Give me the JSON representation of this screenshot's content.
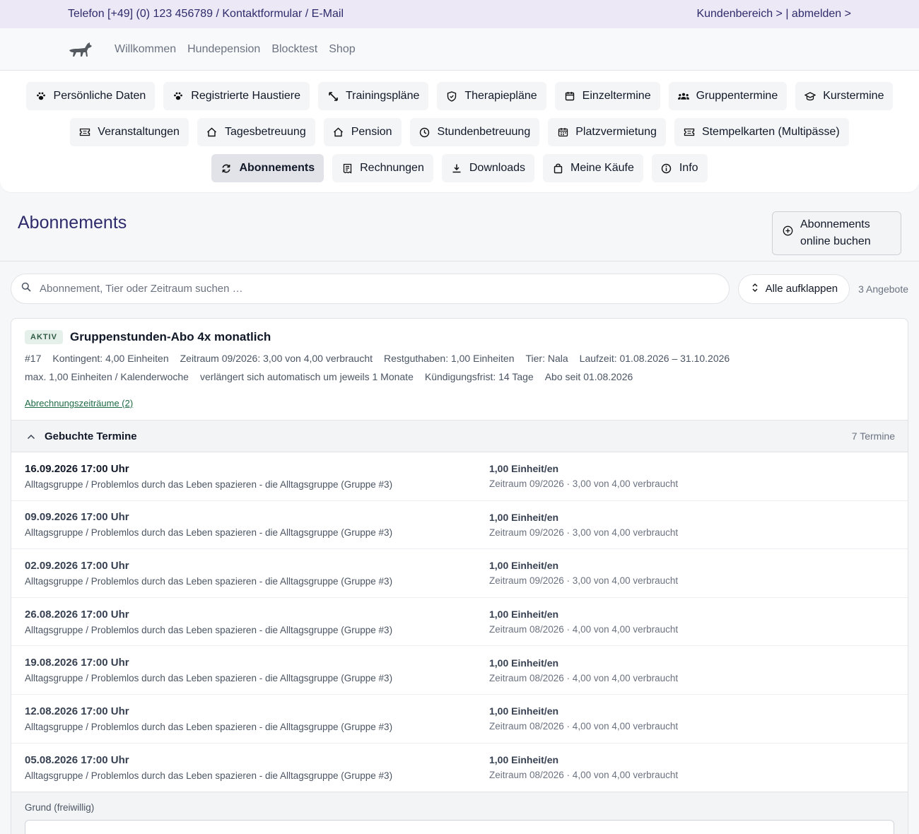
{
  "topbar": {
    "contact": "Telefon [+49] (0) 123 456789 / Kontaktformular / E-Mail",
    "account": "Kundenbereich > | abmelden >"
  },
  "nav": {
    "logo_icon": "dog-silhouette-icon",
    "links": [
      "Willkommen",
      "Hundepension",
      "Blocktest",
      "Shop"
    ]
  },
  "menu": {
    "row1": [
      {
        "label": "Persönliche Daten",
        "icon": "paw-icon"
      },
      {
        "label": "Registrierte Haustiere",
        "icon": "paw-icon"
      },
      {
        "label": "Trainingspläne",
        "icon": "arrows-icon"
      },
      {
        "label": "Therapiepläne",
        "icon": "shield-icon"
      },
      {
        "label": "Einzeltermine",
        "icon": "calendar-icon"
      },
      {
        "label": "Gruppentermine",
        "icon": "group-icon"
      },
      {
        "label": "Kurstermine",
        "icon": "graduation-cap-icon"
      }
    ],
    "row2": [
      {
        "label": "Veranstaltungen",
        "icon": "ticket-icon"
      },
      {
        "label": "Tagesbetreuung",
        "icon": "house-icon"
      },
      {
        "label": "Pension",
        "icon": "house-icon"
      },
      {
        "label": "Stundenbetreuung",
        "icon": "clock-icon"
      },
      {
        "label": "Platzvermietung",
        "icon": "calendar-grid-icon"
      },
      {
        "label": "Stempelkarten (Multipässe)",
        "icon": "ticket-icon"
      }
    ],
    "row3": [
      {
        "label": "Abonnements",
        "icon": "refresh-icon",
        "active": true
      },
      {
        "label": "Rechnungen",
        "icon": "receipt-icon"
      },
      {
        "label": "Downloads",
        "icon": "download-icon"
      },
      {
        "label": "Meine Käufe",
        "icon": "bag-icon"
      },
      {
        "label": "Info",
        "icon": "info-icon"
      }
    ]
  },
  "page": {
    "title": "Abonnements",
    "book_line1": "Abonnements",
    "book_line2": "online buchen"
  },
  "search": {
    "placeholder": "Abonnement, Tier oder Zeitraum suchen …",
    "expand_label": "Alle aufklappen",
    "count": "3 Angebote"
  },
  "subscription": {
    "status": "AKTIV",
    "title": "Gruppenstunden-Abo 4x monatlich",
    "meta1": [
      "#17",
      "Kontingent: 4,00 Einheiten",
      "Zeitraum 09/2026: 3,00 von 4,00 verbraucht",
      "Restguthaben: 1,00 Einheiten",
      "Tier: Nala",
      "Laufzeit: 01.08.2026 – 31.10.2026"
    ],
    "meta2": [
      "max. 1,00 Einheiten / Kalenderwoche",
      "verlängert sich automatisch um jeweils 1 Monate",
      "Kündigungsfrist: 14 Tage",
      "Abo seit 01.08.2026"
    ],
    "periods_link": "Abrechnungszeiträume (2)"
  },
  "booked": {
    "title": "Gebuchte Termine",
    "count": "7 Termine",
    "rows": [
      {
        "date": "16.09.2026 17:00 Uhr",
        "desc": "Alltagsgruppe / Problemlos durch das Leben spazieren - die Alltagsgruppe (Gruppe #3)",
        "units": "1,00 Einheit/en",
        "period": "Zeitraum 09/2026 · 3,00 von 4,00 verbraucht"
      },
      {
        "date": "09.09.2026 17:00 Uhr",
        "desc": "Alltagsgruppe / Problemlos durch das Leben spazieren - die Alltagsgruppe (Gruppe #3)",
        "units": "1,00 Einheit/en",
        "period": "Zeitraum 09/2026 · 3,00 von 4,00 verbraucht"
      },
      {
        "date": "02.09.2026 17:00 Uhr",
        "desc": "Alltagsgruppe / Problemlos durch das Leben spazieren - die Alltagsgruppe (Gruppe #3)",
        "units": "1,00 Einheit/en",
        "period": "Zeitraum 09/2026 · 3,00 von 4,00 verbraucht"
      },
      {
        "date": "26.08.2026 17:00 Uhr",
        "desc": "Alltagsgruppe / Problemlos durch das Leben spazieren - die Alltagsgruppe (Gruppe #3)",
        "units": "1,00 Einheit/en",
        "period": "Zeitraum 08/2026 · 4,00 von 4,00 verbraucht"
      },
      {
        "date": "19.08.2026 17:00 Uhr",
        "desc": "Alltagsgruppe / Problemlos durch das Leben spazieren - die Alltagsgruppe (Gruppe #3)",
        "units": "1,00 Einheit/en",
        "period": "Zeitraum 08/2026 · 4,00 von 4,00 verbraucht"
      },
      {
        "date": "12.08.2026 17:00 Uhr",
        "desc": "Alltagsgruppe / Problemlos durch das Leben spazieren - die Alltagsgruppe (Gruppe #3)",
        "units": "1,00 Einheit/en",
        "period": "Zeitraum 08/2026 · 4,00 von 4,00 verbraucht"
      },
      {
        "date": "05.08.2026 17:00 Uhr",
        "desc": "Alltagsgruppe / Problemlos durch das Leben spazieren - die Alltagsgruppe (Gruppe #3)",
        "units": "1,00 Einheit/en",
        "period": "Zeitraum 08/2026 · 4,00 von 4,00 verbraucht"
      }
    ]
  },
  "reason": {
    "label": "Grund (freiwillig)"
  }
}
